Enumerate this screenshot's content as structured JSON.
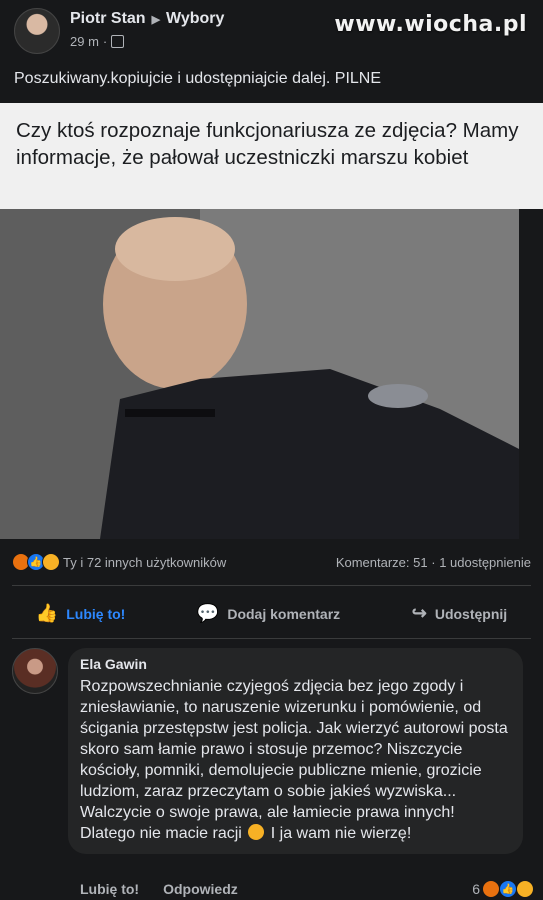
{
  "watermark": "www.wiocha.pl",
  "post": {
    "author": "Piotr Stan",
    "group": "Wybory",
    "time": "29 m",
    "separator": "·",
    "caption": "Poszukiwany.kopiujcie i udostępniajcie dalej. PILNE",
    "quote": "Czy ktoś rozpoznaje funkcjonariusza ze zdjęcia? Mamy informacje, że pałował uczestniczki marszu kobiet"
  },
  "stats": {
    "reactions_text": "Ty i 72 innych użytkowników",
    "comments_text": "Komentarze: 51",
    "dot": "·",
    "shares_text": "1 udostępnienie"
  },
  "actions": {
    "like": "Lubię to!",
    "comment": "Dodaj komentarz",
    "share": "Udostępnij"
  },
  "comment": {
    "author": "Ela Gawin",
    "text_before": "Rozpowszechnianie czyjegoś zdjęcia bez jego zgody i zniesławianie, to naruszenie wizerunku i pomówienie, od ścigania przestępstw jest policja. Jak wierzyć autorowi posta skoro sam łamie prawo i stosuje przemoc? Niszczycie kościoły, pomniki, demolujecie publiczne mienie, grozicie ludziom, zaraz przeczytam o sobie jakieś wyzwiska... Walczycie o swoje prawa, ale łamiecie prawa innych! Dlatego nie macie racji",
    "text_after": "I ja wam nie wierzę!",
    "like_label": "Lubię to!",
    "reply_label": "Odpowiedz",
    "reaction_count": "6"
  },
  "colors": {
    "background": "#17181a",
    "accent_blue": "#2d88ff",
    "bubble": "#242526"
  }
}
